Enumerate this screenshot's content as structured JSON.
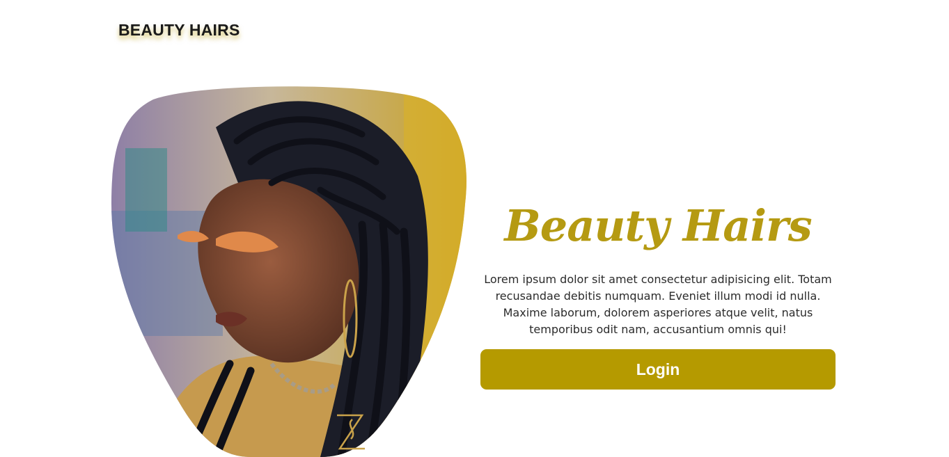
{
  "header": {
    "brand": "BEAUTY HAIRS"
  },
  "hero": {
    "image_alt": "woman with braided hairstyle",
    "logo_icon": "zs-monogram-icon"
  },
  "main": {
    "title": "Beauty Hairs",
    "description": "Lorem ipsum dolor sit amet consectetur adipisicing elit. Totam recusandae debitis numquam. Eveniet illum modi id nulla. Maxime laborum, dolorem asperiores atque velit, natus temporibus odit nam, accusantium omnis qui!",
    "login_label": "Login"
  },
  "colors": {
    "accent": "#b59a00",
    "title": "#b59a12",
    "text": "#2b2b2b"
  }
}
